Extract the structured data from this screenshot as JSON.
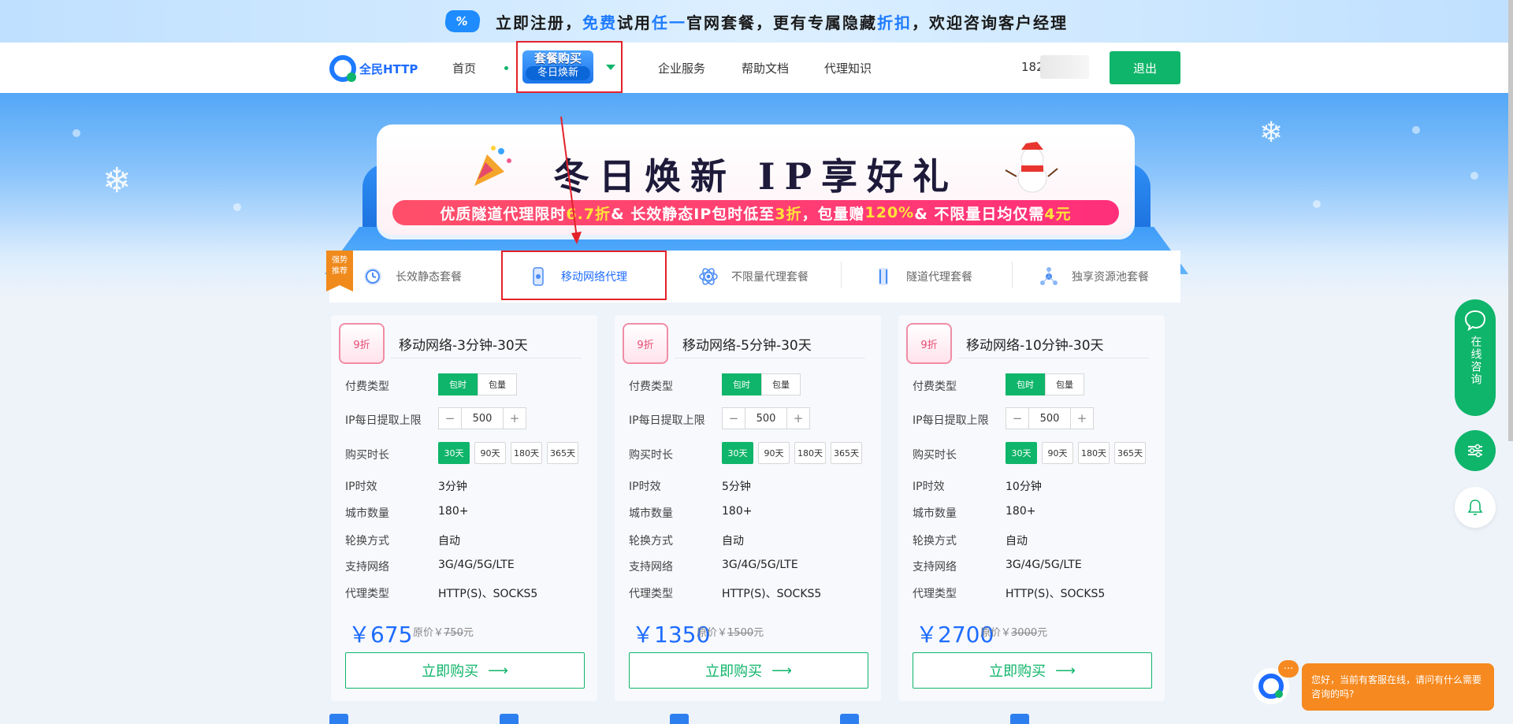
{
  "promo": {
    "badge": "%",
    "t1": "立即注册，",
    "t2": "免费",
    "t3": "试用",
    "t4": "任一",
    "t5": "官网套餐，更有专属隐藏",
    "t6": "折扣",
    "t7": "，欢迎咨询客户经理"
  },
  "nav": {
    "logo": "全民HTTP",
    "home": "首页",
    "pkg_line1": "套餐购买",
    "pkg_line2": "冬日焕新",
    "enterprise": "企业服务",
    "help": "帮助文档",
    "knowledge": "代理知识",
    "phone": "182",
    "logout": "退出"
  },
  "banner": {
    "title": "冬日焕新 IP享好礼",
    "sub_a": "优质隧道代理限时",
    "sub_b": "6.7折",
    "sub_c": " & 长效静态IP包时低至",
    "sub_d": "3折",
    "sub_e": "，包量赠",
    "sub_f": "120%",
    "sub_g": " & 不限量日均仅需",
    "sub_h": "4元"
  },
  "tabs": {
    "hot": [
      "强势",
      "推荐"
    ],
    "items": [
      "长效静态套餐",
      "移动网络代理",
      "不限量代理套餐",
      "隧道代理套餐",
      "独享资源池套餐"
    ],
    "active_index": 1
  },
  "labels": {
    "pay_type": "付费类型",
    "limit": "IP每日提取上限",
    "duration": "购买时长",
    "ip_valid": "IP时效",
    "cities": "城市数量",
    "rotate": "轮换方式",
    "network": "支持网络",
    "proxy_type": "代理类型",
    "orig": "原价",
    "buy": "立即购买"
  },
  "pay_options": [
    "包时",
    "包量"
  ],
  "duration_options": [
    "30天",
    "90天",
    "180天",
    "365天"
  ],
  "cards": [
    {
      "discount": "9折",
      "title": "移动网络-3分钟-30天",
      "limit": "500",
      "ip_valid": "3分钟",
      "cities": "180+",
      "rotate": "自动",
      "network": "3G/4G/5G/LTE",
      "proxy_type": "HTTP(S)、SOCKS5",
      "price": "￥675",
      "orig_prefix": "￥",
      "orig": "750",
      "orig_unit": "元"
    },
    {
      "discount": "9折",
      "title": "移动网络-5分钟-30天",
      "limit": "500",
      "ip_valid": "5分钟",
      "cities": "180+",
      "rotate": "自动",
      "network": "3G/4G/5G/LTE",
      "proxy_type": "HTTP(S)、SOCKS5",
      "price": "￥1350",
      "orig_prefix": "￥",
      "orig": "1500",
      "orig_unit": "元"
    },
    {
      "discount": "9折",
      "title": "移动网络-10分钟-30天",
      "limit": "500",
      "ip_valid": "10分钟",
      "cities": "180+",
      "rotate": "自动",
      "network": "3G/4G/5G/LTE",
      "proxy_type": "HTTP(S)、SOCKS5",
      "price": "￥2700",
      "orig_prefix": "￥",
      "orig": "3000",
      "orig_unit": "元"
    }
  ],
  "side": {
    "consult": "在线咨询"
  },
  "chat": {
    "dots": "···",
    "message": "您好，当前有客服在线，请问有什么需要咨询的吗?"
  },
  "colors": {
    "accent": "#0fb56a",
    "brand": "#1e6cff",
    "highlight": "#e3222a"
  }
}
